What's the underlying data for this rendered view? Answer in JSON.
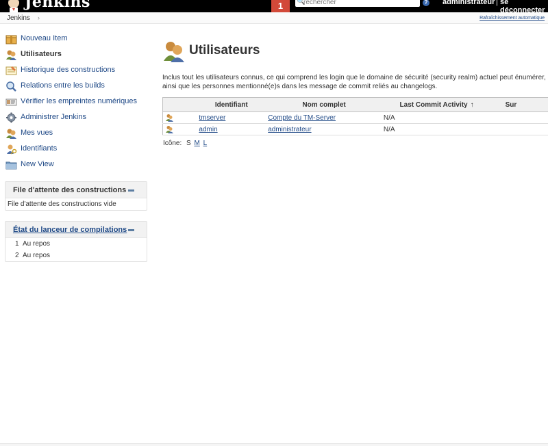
{
  "header": {
    "brand": "Jenkins",
    "notification_count": "1",
    "search_placeholder": "rechercher",
    "user": "administrateur",
    "separator": "|",
    "logout": "se déconnecter",
    "help_symbol": "?"
  },
  "breadcrumb": {
    "items": [
      "Jenkins"
    ],
    "arrow": "›",
    "auto_refresh": "Rafraîchissement automatique"
  },
  "sidebar": {
    "tasks": [
      {
        "label": "Nouveau Item",
        "icon": "new-package-icon"
      },
      {
        "label": "Utilisateurs",
        "icon": "users-icon"
      },
      {
        "label": "Historique des constructions",
        "icon": "notepad-icon"
      },
      {
        "label": "Relations entre les builds",
        "icon": "search-magnifier-icon"
      },
      {
        "label": "Vérifier les empreintes numériques",
        "icon": "fingerprint-card-icon"
      },
      {
        "label": "Administrer Jenkins",
        "icon": "gear-icon"
      },
      {
        "label": "Mes vues",
        "icon": "user-group-icon"
      },
      {
        "label": "Identifiants",
        "icon": "credentials-icon"
      },
      {
        "label": "New View",
        "icon": "folder-icon"
      }
    ],
    "build_queue": {
      "title": "File d'attente des constructions",
      "empty": "File d'attente des constructions vide"
    },
    "executors": {
      "title": "État du lanceur de compilations",
      "rows": [
        {
          "num": "1",
          "status": "Au repos"
        },
        {
          "num": "2",
          "status": "Au repos"
        }
      ]
    }
  },
  "main": {
    "title": "Utilisateurs",
    "description": "Inclus tout les utilisateurs connus, ce qui comprend les login que le domaine de sécurité (security realm) actuel peut énumérer, ainsi que les personnes mentionné(e)s dans les message de commit reliés au changelogs.",
    "table": {
      "headers": [
        "",
        "Identifiant",
        "Nom complet",
        "Last Commit Activity",
        "Sur"
      ],
      "sort_arrow": "↑",
      "rows": [
        {
          "id": "tmserver",
          "name": "Compte du TM-Server",
          "last": "N/A",
          "on": ""
        },
        {
          "id": "admin",
          "name": "administrateur",
          "last": "N/A",
          "on": ""
        }
      ]
    },
    "icon_size": {
      "label": "Icône:",
      "current": "S",
      "options": [
        "M",
        "L"
      ]
    }
  },
  "colors": {
    "header_bg": "#000000",
    "notification_bg": "#d24939",
    "link": "#204a87",
    "pane_header_bg": "#f2f2f2"
  }
}
